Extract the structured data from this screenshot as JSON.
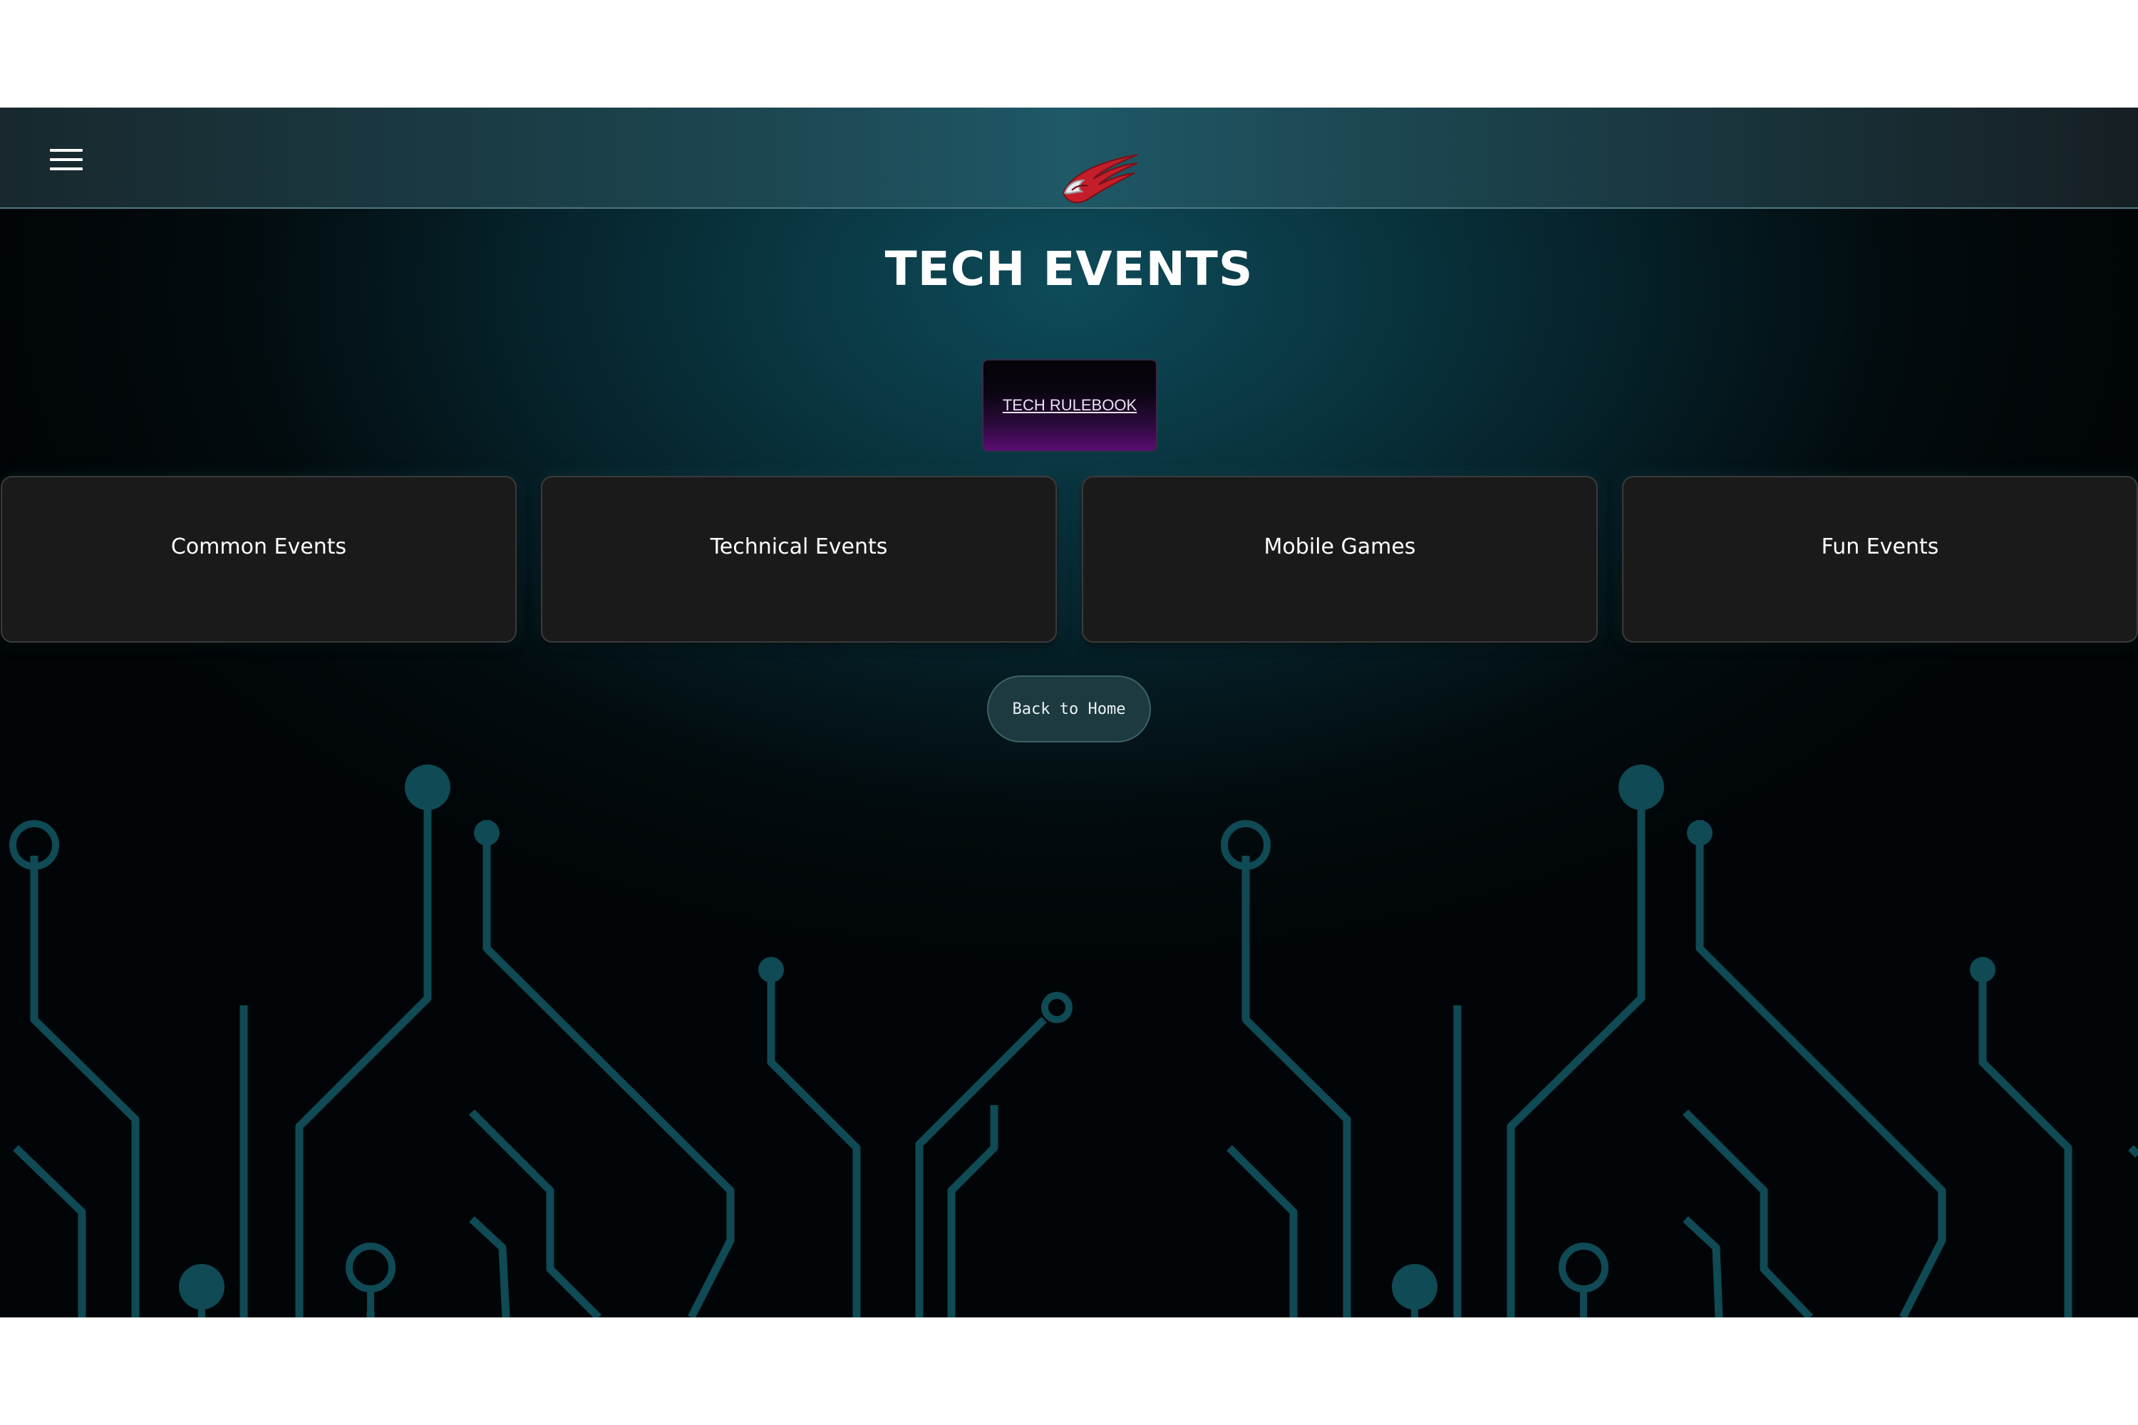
{
  "navbar": {
    "menu_icon": "hamburger-menu-icon",
    "logo_icon": "red-wing-logo"
  },
  "page": {
    "title": "TECH EVENTS"
  },
  "rulebook": {
    "label": "TECH RULEBOOK"
  },
  "categories": [
    {
      "label": "Common Events"
    },
    {
      "label": "Technical Events"
    },
    {
      "label": "Mobile Games"
    },
    {
      "label": "Fun Events"
    }
  ],
  "back_button": {
    "label": "Back to Home"
  },
  "colors": {
    "background_teal": "#0e4b59",
    "card_background": "#1a1a1a",
    "rulebook_purple": "#5a0d73",
    "circuit_lines": "#0f4a55",
    "logo_red": "#c41e2a"
  }
}
